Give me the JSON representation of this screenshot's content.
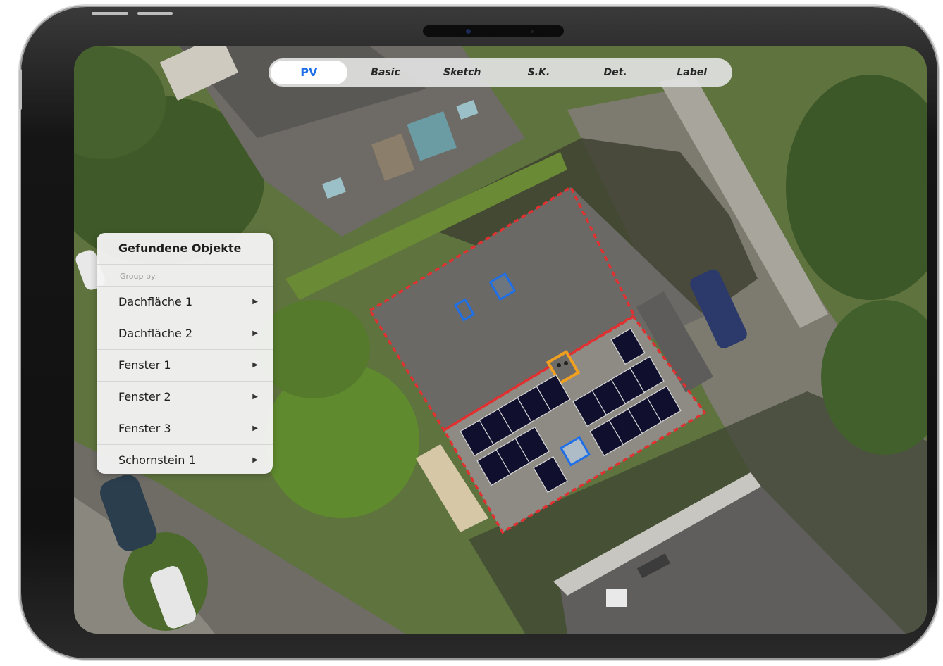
{
  "tabs": {
    "items": [
      "PV",
      "Basic",
      "Sketch",
      "S.K.",
      "Det.",
      "Label"
    ],
    "active": "PV"
  },
  "panel": {
    "title": "Gefundene Objekte",
    "group_by": "Group by:",
    "items": [
      "Dachfläche 1",
      "Dachfläche 2",
      "Fenster 1",
      "Fenster 2",
      "Fenster 3",
      "Schornstein 1"
    ]
  },
  "colors": {
    "accent": "#1f6fe8",
    "roof_outline": "#e03030",
    "window_outline": "#1f6fe8",
    "chimney_outline": "#f0a020",
    "solar_panel": "#10102e"
  },
  "icons": {
    "disclosure": "triangle-right-icon"
  }
}
